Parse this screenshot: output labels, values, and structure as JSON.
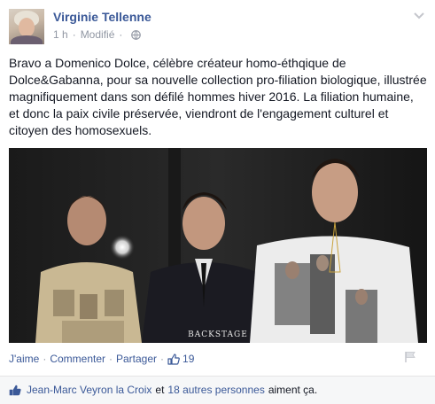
{
  "post": {
    "author": "Virginie Tellenne",
    "time": "1 h",
    "separator": "·",
    "edited": "Modifié",
    "privacy_icon": "globe-icon",
    "message": "Bravo a Domenico Dolce, célèbre créateur homo-éthqique de Dolce&Gabanna, pour sa nouvelle collection pro-filiation biologique, illustrée magnifiquement dans son défilé hommes hiver 2016. La filiation humaine, et donc la paix civile préservée, viendront de l'engagement culturel et citoyen des homosexuels.",
    "image_watermark": "BACKSTAGE"
  },
  "actions": {
    "like": "J'aime",
    "comment": "Commenter",
    "share": "Partager",
    "dot": "·",
    "like_count": "19"
  },
  "likes_bar": {
    "first_name": "Jean-Marc Veyron la Croix",
    "and": "et",
    "others": "18 autres personnes",
    "suffix": "aiment ça."
  },
  "colors": {
    "link": "#3b5998",
    "meta": "#9197a3",
    "text": "#141823",
    "bar_bg": "#f6f7f8"
  }
}
